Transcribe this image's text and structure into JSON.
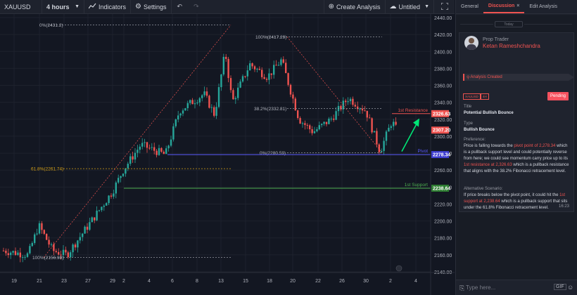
{
  "toolbar": {
    "symbol": "XAUUSD",
    "interval": "4 hours",
    "indicators_label": "Indicators",
    "settings_label": "Settings",
    "create_analysis_label": "Create Analysis",
    "untitled_label": "Untitled"
  },
  "chart": {
    "price_axis": {
      "ticks": [
        "2440.00",
        "2420.00",
        "2400.00",
        "2380.00",
        "2360.00",
        "2340.00",
        "2320.00",
        "2300.00",
        "2280.00",
        "2260.00",
        "2240.00",
        "2220.00",
        "2200.00",
        "2180.00",
        "2160.00",
        "2140.00"
      ],
      "ticks_values": [
        2440,
        2420,
        2400,
        2380,
        2360,
        2340,
        2320,
        2300,
        2280,
        2260,
        2240,
        2220,
        2200,
        2180,
        2160,
        2140
      ],
      "badges": {
        "resistance": "2326.63",
        "current": "2307.20",
        "pivot": "2278.34",
        "support": "2238.64"
      }
    },
    "time_axis": {
      "ticks": [
        "19",
        "21",
        "23",
        "27",
        "29",
        "2",
        "4",
        "6",
        "8",
        "13",
        "15",
        "18",
        "20",
        "22",
        "26",
        "30",
        "2",
        "4"
      ]
    },
    "fib_labels": {
      "top_left": "0%(2431.2)",
      "mid_left": "61.8%(2261.74)",
      "bottom_left": "100%(2156.98)",
      "top_right": "100%(2417.29)",
      "mid_right": "38.2%(2332.81)",
      "bottom_right": "0%(2280.59)"
    },
    "level_labels": {
      "resistance": "1st Resistance",
      "pivot": "Pivot",
      "support": "1st Support"
    },
    "colors": {
      "up": "#26a69a",
      "down": "#ef5350",
      "resistance": "#ef5350",
      "pivot": "#5b5bff",
      "support": "#4caf50",
      "arrow": "#00e676",
      "fib_mid": "#d4a017"
    }
  },
  "panel": {
    "tabs": [
      "General",
      "Discussion",
      "Edit Analysis"
    ],
    "tab_close": "×",
    "today_label": "Today",
    "role": "Prop Trader",
    "author": "Ketan Rameshchandra",
    "status_created": "Analysis Created",
    "symbol_badge": "XAUUSD",
    "interval_badge": "4H",
    "pending_label": "Pending",
    "title_label": "Title",
    "title_value": "Potential Bullish Bounce",
    "type_label": "Type",
    "type_value": "Bullish Bounce",
    "preference_label": "Preference:",
    "preference": {
      "t1": "Price is falling towards the ",
      "h1": "pivot point of 2,278.34",
      "t2": " which is a pullback support level and could potentially reverse from here; we could see momentum carry price up to its ",
      "h2": "1st resistance at 2,326.63",
      "t3": " which is a pullback resistance that aligns with the 38.2% Fibonacci retracement level."
    },
    "alt_label": "Alternative Scenario:",
    "alternative": {
      "t1": "If price breaks below the pivot point, it could hit the ",
      "h1": "1st support at 2,238.64",
      "t2": " which is a pullback support that sits under the 61.8% Fibonacci retracement level."
    },
    "time": "16:23",
    "input_placeholder": "Type here...",
    "gif_label": "GIF"
  },
  "icons": [
    "indicators-icon",
    "settings-icon",
    "undo-icon",
    "redo-icon",
    "plus-circle-icon",
    "cloud-icon",
    "fullscreen-icon",
    "attach-icon",
    "emoji-icon",
    "chevron-down-icon"
  ]
}
